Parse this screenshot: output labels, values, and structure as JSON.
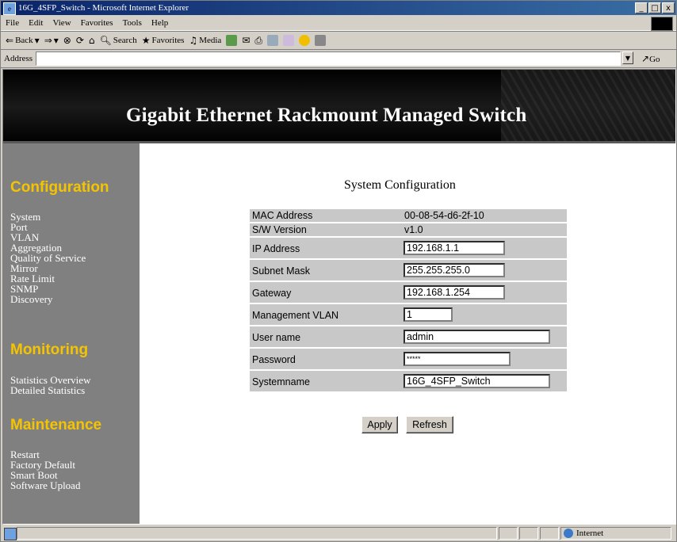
{
  "window": {
    "title": "16G_4SFP_Switch - Microsoft Internet Explorer",
    "controls": {
      "minimize": "_",
      "maximize": "□",
      "close": "x"
    }
  },
  "menu": [
    "File",
    "Edit",
    "View",
    "Favorites",
    "Tools",
    "Help"
  ],
  "toolbar": {
    "back": "Back",
    "search": "Search",
    "favorites": "Favorites",
    "media": "Media"
  },
  "address": {
    "label": "Address",
    "value": "",
    "go": "Go"
  },
  "banner": {
    "title": "Gigabit Ethernet Rackmount Managed Switch"
  },
  "sidebar": {
    "sections": [
      {
        "title": "Configuration",
        "items": [
          "System",
          "Port",
          "VLAN",
          "Aggregation",
          "Quality of Service",
          "Mirror",
          "Rate Limit",
          "SNMP",
          "Discovery"
        ]
      },
      {
        "title": "Monitoring",
        "items": [
          "Statistics Overview",
          "Detailed Statistics"
        ]
      },
      {
        "title": "Maintenance",
        "items": [
          "Restart",
          "Factory Default",
          "Smart Boot",
          "Software Upload"
        ]
      }
    ]
  },
  "main": {
    "title": "System Configuration",
    "fields": {
      "mac": {
        "label": "MAC Address",
        "value": "00-08-54-d6-2f-10"
      },
      "sw": {
        "label": "S/W Version",
        "value": "v1.0"
      },
      "ip": {
        "label": "IP Address",
        "value": "192.168.1.1"
      },
      "mask": {
        "label": "Subnet Mask",
        "value": "255.255.255.0"
      },
      "gateway": {
        "label": "Gateway",
        "value": "192.168.1.254"
      },
      "mgmt_vlan": {
        "label": "Management VLAN",
        "value": "1"
      },
      "user": {
        "label": "User name",
        "value": "admin"
      },
      "password": {
        "label": "Password",
        "value": "*****"
      },
      "sysname": {
        "label": "Systemname",
        "value": "16G_4SFP_Switch"
      }
    },
    "apply_label": "Apply",
    "refresh_label": "Refresh"
  },
  "status": {
    "zone": "Internet"
  },
  "colors": {
    "sidebar_bg": "#808080",
    "section_title": "#f5c400",
    "row_bg": "#c8c8c8",
    "banner_bg": "#0e0e0e"
  }
}
